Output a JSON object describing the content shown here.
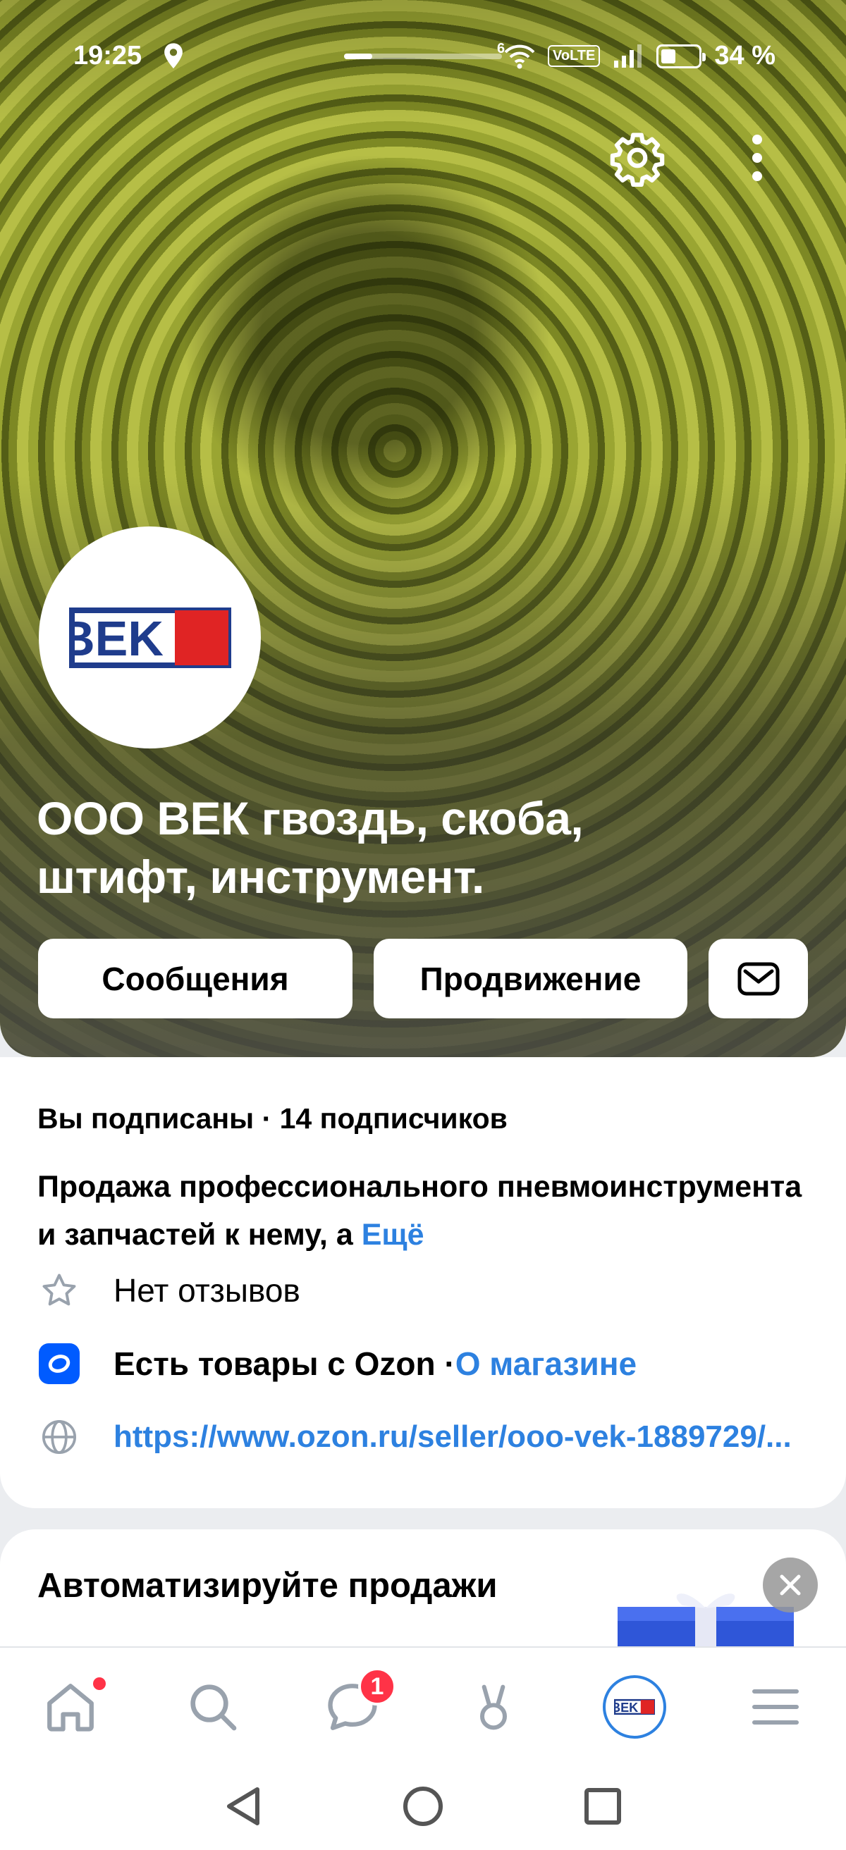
{
  "status_bar": {
    "time": "19:25",
    "network": "6",
    "volte": "VoLTE",
    "battery": "34 %",
    "battery_level": 0.34
  },
  "profile": {
    "logo_text": "BEK",
    "name": "ООО ВЕК гвоздь, скоба, штифт, инструмент.",
    "buttons": {
      "messages": "Сообщения",
      "promotion": "Продвижение"
    }
  },
  "info": {
    "subscription": "Вы подписаны · 14 подписчиков",
    "description": "Продажа профессионального пневмоинструмента и запчастей к нему, а",
    "description_more": "Ещё",
    "reviews": "Нет отзывов",
    "ozon_text": "Есть товары с Ozon · ",
    "ozon_link": "О магазине",
    "website": "https://www.ozon.ru/seller/ooo-vek-1889729/..."
  },
  "promo_card": {
    "title": "Автоматизируйте продажи"
  },
  "tab_bar": {
    "messages_badge": "1",
    "profile_logo": "BEK"
  },
  "colors": {
    "accent": "#2d81e0",
    "badge": "#ff3347",
    "ozon": "#005bff",
    "logo_blue": "#1f3c8c",
    "logo_red": "#e02424"
  },
  "icons": [
    "location-icon",
    "wifi-icon",
    "signal-icon",
    "battery-icon",
    "settings-icon",
    "more-icon",
    "mail-icon",
    "star-icon",
    "ozon-icon",
    "globe-icon",
    "close-icon",
    "home-icon",
    "search-icon",
    "messages-icon",
    "clips-icon",
    "menu-icon",
    "back-icon",
    "circle-home-icon",
    "recent-icon"
  ]
}
